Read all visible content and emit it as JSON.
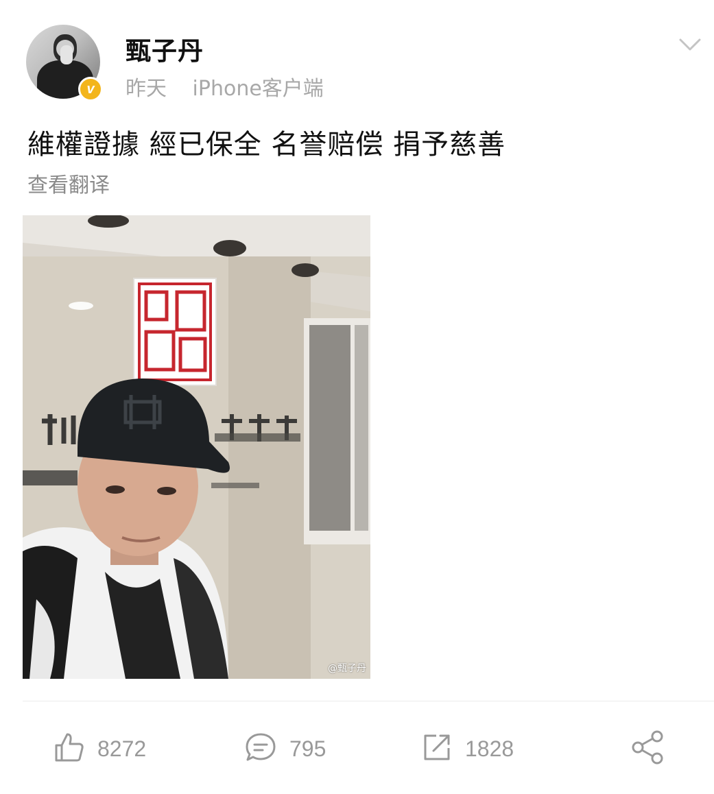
{
  "post": {
    "user": {
      "name": "甄子丹",
      "verified_badge": "v",
      "badge_color": "#f3b51b"
    },
    "time": "昨天",
    "source": "iPhone客户端",
    "text": "維權證據 經已保全 名誉赔偿 捐予慈善",
    "translate_label": "查看翻译",
    "image": {
      "watermark": "@甄子丹",
      "description_icon": "photo"
    }
  },
  "actions": {
    "like_count": "8272",
    "comment_count": "795",
    "repost_count": "1828"
  },
  "colors": {
    "text_primary": "#111111",
    "text_secondary": "#a8a8a8",
    "icon": "#999999"
  }
}
